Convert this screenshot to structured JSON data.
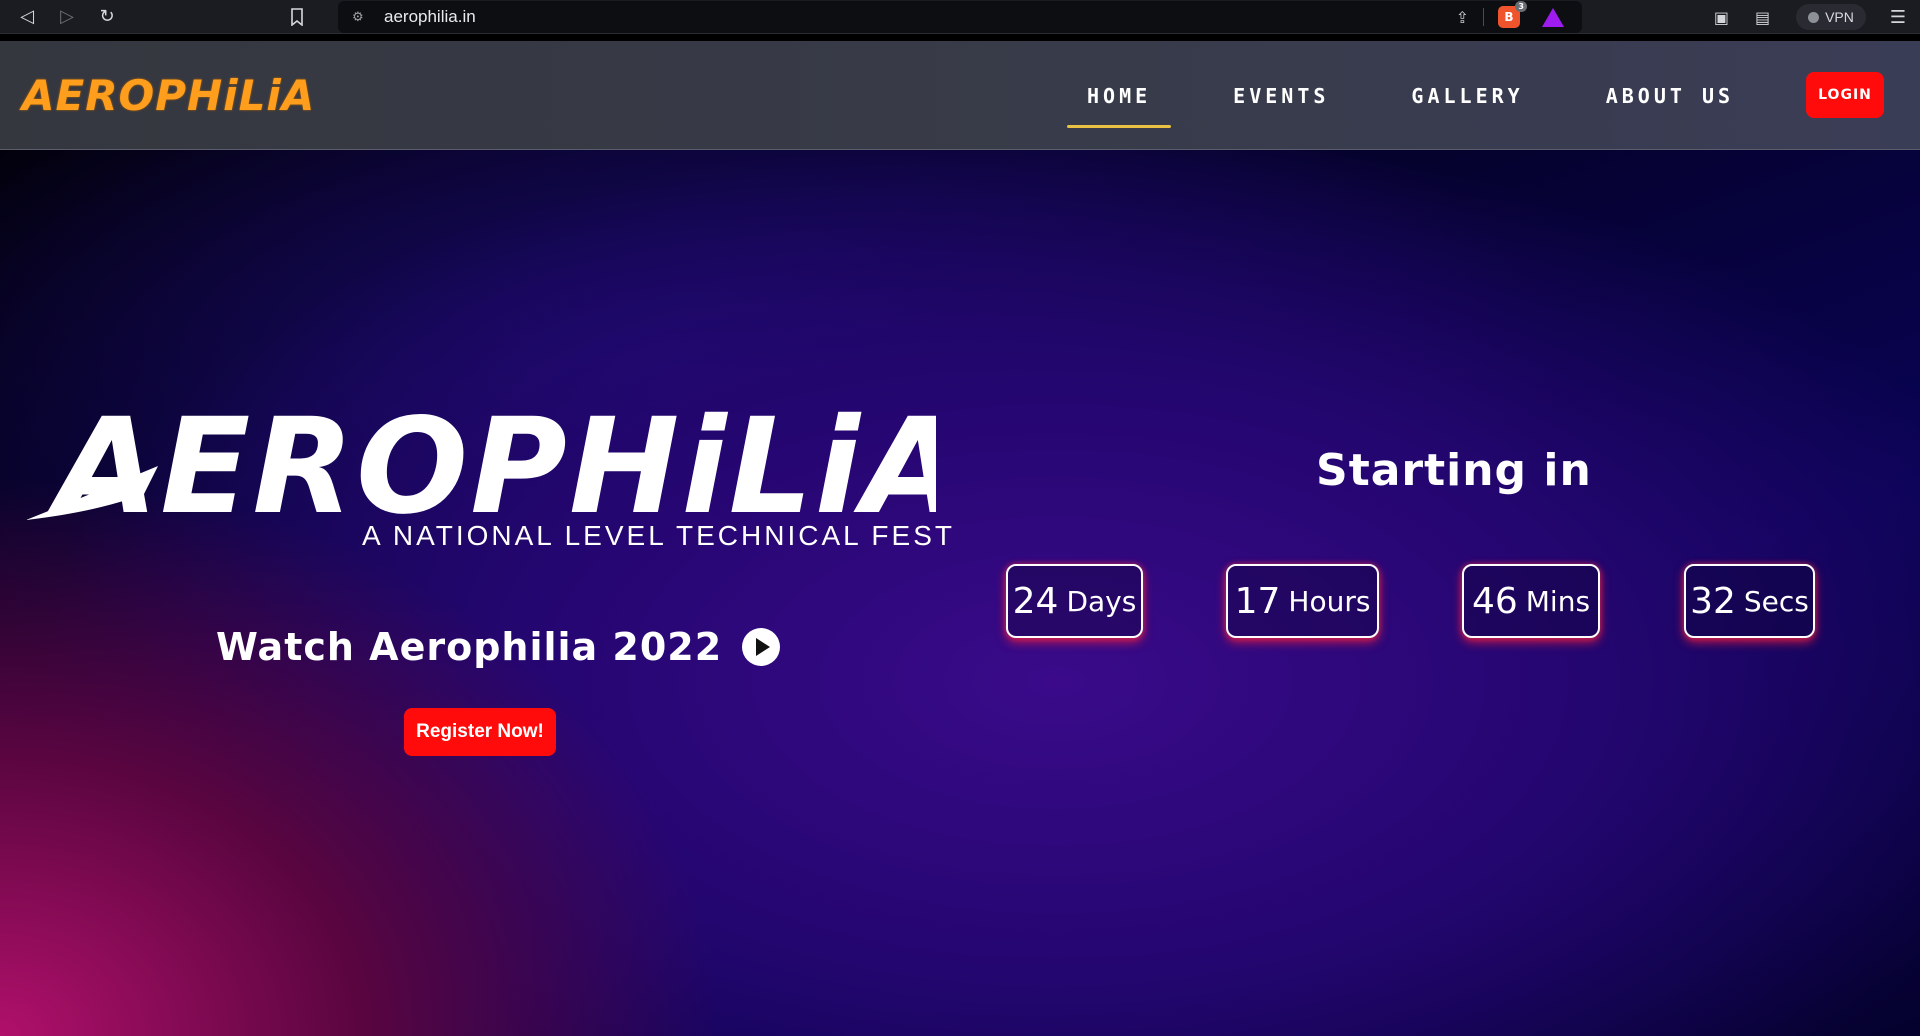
{
  "browser": {
    "url": "aerophilia.in",
    "brave_badge": "3",
    "vpn_label": "VPN"
  },
  "header": {
    "brand": "AEROPHiLiA",
    "nav": [
      {
        "label": "HOME",
        "active": true
      },
      {
        "label": "EVENTS",
        "active": false
      },
      {
        "label": "GALLERY",
        "active": false
      },
      {
        "label": "ABOUT US",
        "active": false
      }
    ],
    "login_label": "LOGIN"
  },
  "hero": {
    "logo_text": "AEROPHiLiA",
    "tagline": "A NATIONAL LEVEL TECHNICAL FEST",
    "watch_label": "Watch Aerophilia 2022",
    "register_label": "Register Now!",
    "starting_label": "Starting in",
    "countdown": [
      {
        "value": "24",
        "unit": "Days"
      },
      {
        "value": "17",
        "unit": "Hours"
      },
      {
        "value": "46",
        "unit": "Mins"
      },
      {
        "value": "32",
        "unit": "Secs"
      }
    ]
  },
  "colors": {
    "accent_orange": "#ff9d1c",
    "button_red": "#ff0b0b",
    "nav_underline": "#e9c244"
  }
}
